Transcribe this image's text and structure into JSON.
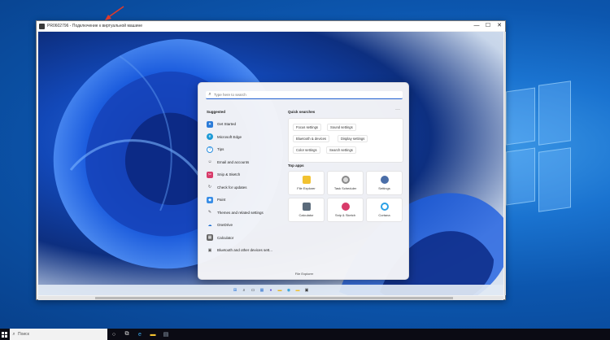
{
  "vm_window": {
    "title": "PR0602796 - Подключение к виртуальной машине",
    "controls": [
      "—",
      "☐",
      "✕"
    ]
  },
  "start_menu": {
    "search_placeholder": "Type here to search",
    "suggested_title": "Suggested",
    "suggested": [
      {
        "label": "Get Started",
        "icon": "get-started-icon",
        "color": "#2b7bd8"
      },
      {
        "label": "Microsoft Edge",
        "icon": "edge-icon",
        "color": "#1c9ad6"
      },
      {
        "label": "Tips",
        "icon": "tips-icon",
        "color": "#2a8fe0"
      },
      {
        "label": "Email and accounts",
        "icon": "person-icon",
        "color": "#555555"
      },
      {
        "label": "Snip & Sketch",
        "icon": "snip-sketch-icon",
        "color": "#d83b6a"
      },
      {
        "label": "Check for updates",
        "icon": "refresh-icon",
        "color": "#555555"
      },
      {
        "label": "Paint",
        "icon": "paint-icon",
        "color": "#3a8ee6"
      },
      {
        "label": "Themes and related settings",
        "icon": "brush-icon",
        "color": "#555555"
      },
      {
        "label": "OneDrive",
        "icon": "onedrive-icon",
        "color": "#1e6fd0"
      },
      {
        "label": "Calculator",
        "icon": "calculator-icon",
        "color": "#666666"
      },
      {
        "label": "Bluetooth and other devices sett...",
        "icon": "bluetooth-icon",
        "color": "#555555"
      }
    ],
    "quick_searches_title": "Quick searches",
    "quick_searches": [
      "Focus settings",
      "Sound settings",
      "Bluetooth & devices",
      "Display settings",
      "Color settings",
      "Search settings"
    ],
    "top_apps_title": "Top apps",
    "top_apps": [
      {
        "label": "File Explorer",
        "icon": "folder-icon",
        "color": "#f2c230"
      },
      {
        "label": "Task Scheduler",
        "icon": "clock-icon",
        "color": "#8a8a8a"
      },
      {
        "label": "Settings",
        "icon": "gear-icon",
        "color": "#4a6ea8"
      },
      {
        "label": "Calculator",
        "icon": "calculator-icon",
        "color": "#5a6a7a"
      },
      {
        "label": "Snip & Sketch",
        "icon": "snip-sketch-icon",
        "color": "#d83b6a"
      },
      {
        "label": "Cortana",
        "icon": "cortana-icon",
        "color": "#2aa0e6"
      }
    ],
    "footer_label": "File Explorer"
  },
  "vm_taskbar": [
    {
      "name": "windows-start-icon",
      "glyph": "⊞",
      "color": "#1c6fd8"
    },
    {
      "name": "search-icon",
      "glyph": "⌕",
      "color": "#222"
    },
    {
      "name": "task-view-icon",
      "glyph": "▭",
      "color": "#222"
    },
    {
      "name": "widgets-icon",
      "glyph": "▦",
      "color": "#2a6fd0"
    },
    {
      "name": "chat-icon",
      "glyph": "●",
      "color": "#6a5ad6"
    },
    {
      "name": "file-explorer-icon",
      "glyph": "▬",
      "color": "#e8b82a"
    },
    {
      "name": "edge-icon",
      "glyph": "◉",
      "color": "#1c9ad6"
    },
    {
      "name": "folder-icon",
      "glyph": "▬",
      "color": "#f2c230"
    },
    {
      "name": "store-icon",
      "glyph": "▣",
      "color": "#333"
    }
  ],
  "host_taskbar": {
    "search_placeholder": "Поиск",
    "icons": [
      {
        "name": "cortana-icon",
        "glyph": "○"
      },
      {
        "name": "task-view-icon",
        "glyph": "⧉"
      },
      {
        "name": "edge-icon",
        "glyph": "e"
      },
      {
        "name": "folder-icon",
        "glyph": "▬"
      },
      {
        "name": "hyperv-icon",
        "glyph": "▤"
      }
    ]
  },
  "colors": {
    "accent": "#2060d0",
    "annotation_arrow": "#e03a2a"
  }
}
